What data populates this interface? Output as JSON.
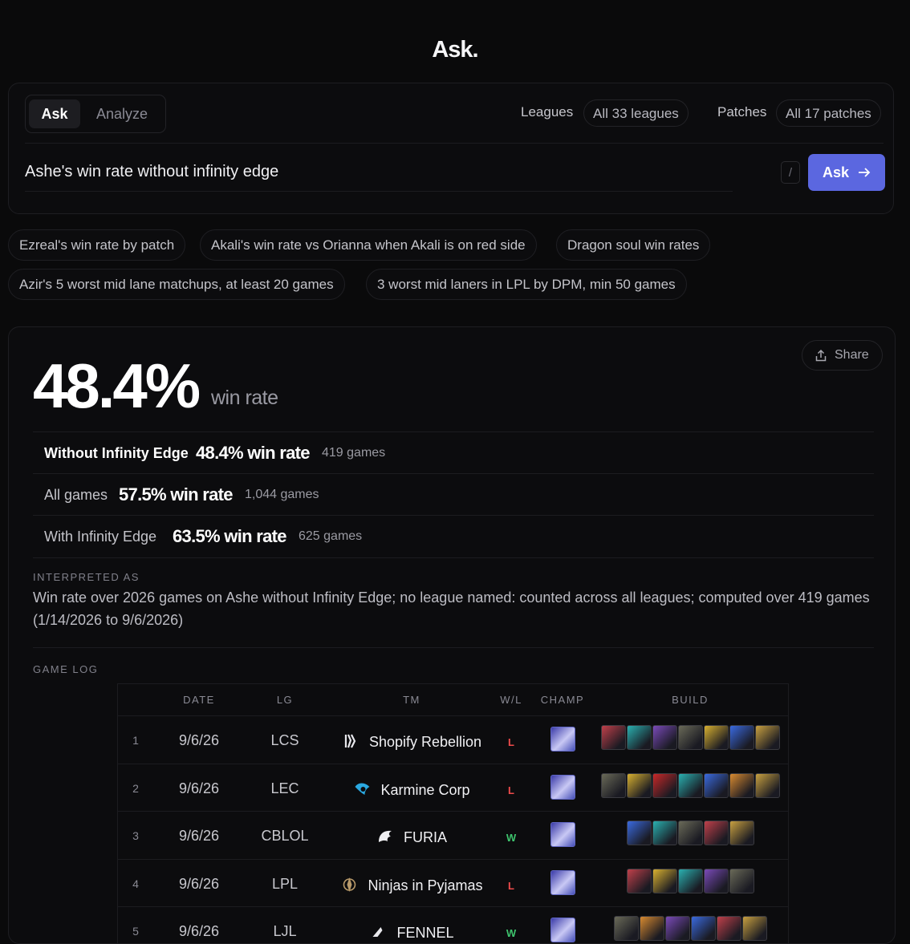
{
  "app_title": "Ask.",
  "mode_tabs": [
    "Ask",
    "Analyze"
  ],
  "filters": {
    "leagues_label": "Leagues",
    "leagues_value": "All 33 leagues",
    "patches_label": "Patches",
    "patches_value": "All 17 patches"
  },
  "query": {
    "text": "Ashe's win rate without infinity edge",
    "shortcut_hint": "/",
    "submit_label": "Ask",
    "submit_icon": "arrow-right-icon"
  },
  "suggestions": [
    "Ezreal's win rate by patch",
    "Akali's win rate vs Orianna when Akali is on red side",
    "Dragon soul win rates",
    "Azir's 5 worst mid lane matchups, at least 20 games",
    "3 worst mid laners in LPL by DPM, min 50 games"
  ],
  "result": {
    "share_label": "Share",
    "share_icon": "share-icon",
    "headline_value": "48.4%",
    "headline_unit": "win rate",
    "breakdown": [
      {
        "label": "Without Infinity Edge",
        "value": "48.4% win rate",
        "games": "419 games",
        "highlight": true
      },
      {
        "label": "All games",
        "value": "57.5% win rate",
        "games": "1,044 games",
        "highlight": false
      },
      {
        "label": "With Infinity Edge",
        "value": "63.5% win rate",
        "games": "625 games",
        "highlight": false
      }
    ],
    "interpreted_label": "INTERPRETED AS",
    "interpreted_text": "Win rate over 2026 games on Ashe without Infinity Edge; no league named: counted across all leagues; computed over 419 games (1/14/2026 to 9/6/2026)",
    "game_log_label": "GAME LOG",
    "game_log": {
      "columns": [
        "DATE",
        "LG",
        "TM",
        "W/L",
        "CHAMP",
        "BUILD"
      ],
      "rows": [
        {
          "n": "1",
          "date": "9/6/26",
          "league": "LCS",
          "team": "Shopify Rebellion",
          "result": "L",
          "champ": "Ashe",
          "build": [
            "#c0404a",
            "#2ab0b0",
            "#7a4ab8",
            "#6a6a58",
            "#d8b030",
            "#3a6ae0",
            "#c8a040"
          ]
        },
        {
          "n": "2",
          "date": "9/6/26",
          "league": "LEC",
          "team": "Karmine Corp",
          "result": "L",
          "champ": "Ashe",
          "build": [
            "#6a6a58",
            "#d8b030",
            "#c82828",
            "#2ab0b0",
            "#3a6ae0",
            "#d88a30",
            "#c8a040"
          ]
        },
        {
          "n": "3",
          "date": "9/6/26",
          "league": "CBLOL",
          "team": "FURIA",
          "result": "W",
          "champ": "Ashe",
          "build": [
            "#3a6ae0",
            "#2ab0b0",
            "#6a6a58",
            "#c0404a",
            "#c8a040"
          ]
        },
        {
          "n": "4",
          "date": "9/6/26",
          "league": "LPL",
          "team": "Ninjas in Pyjamas",
          "result": "L",
          "champ": "Ashe",
          "build": [
            "#c0404a",
            "#d8b030",
            "#2ab0b0",
            "#7a4ab8",
            "#6a6a58"
          ]
        },
        {
          "n": "5",
          "date": "9/6/26",
          "league": "LJL",
          "team": "FENNEL",
          "result": "W",
          "champ": "Ashe",
          "build": [
            "#6a6a58",
            "#d88a30",
            "#7a4ab8",
            "#3a6ae0",
            "#c0404a",
            "#c8a040"
          ]
        }
      ]
    }
  },
  "colors": {
    "accent": "#5b67e0",
    "win": "#3ec46d",
    "loss": "#ef4b4b",
    "background": "#0a0a0b"
  }
}
